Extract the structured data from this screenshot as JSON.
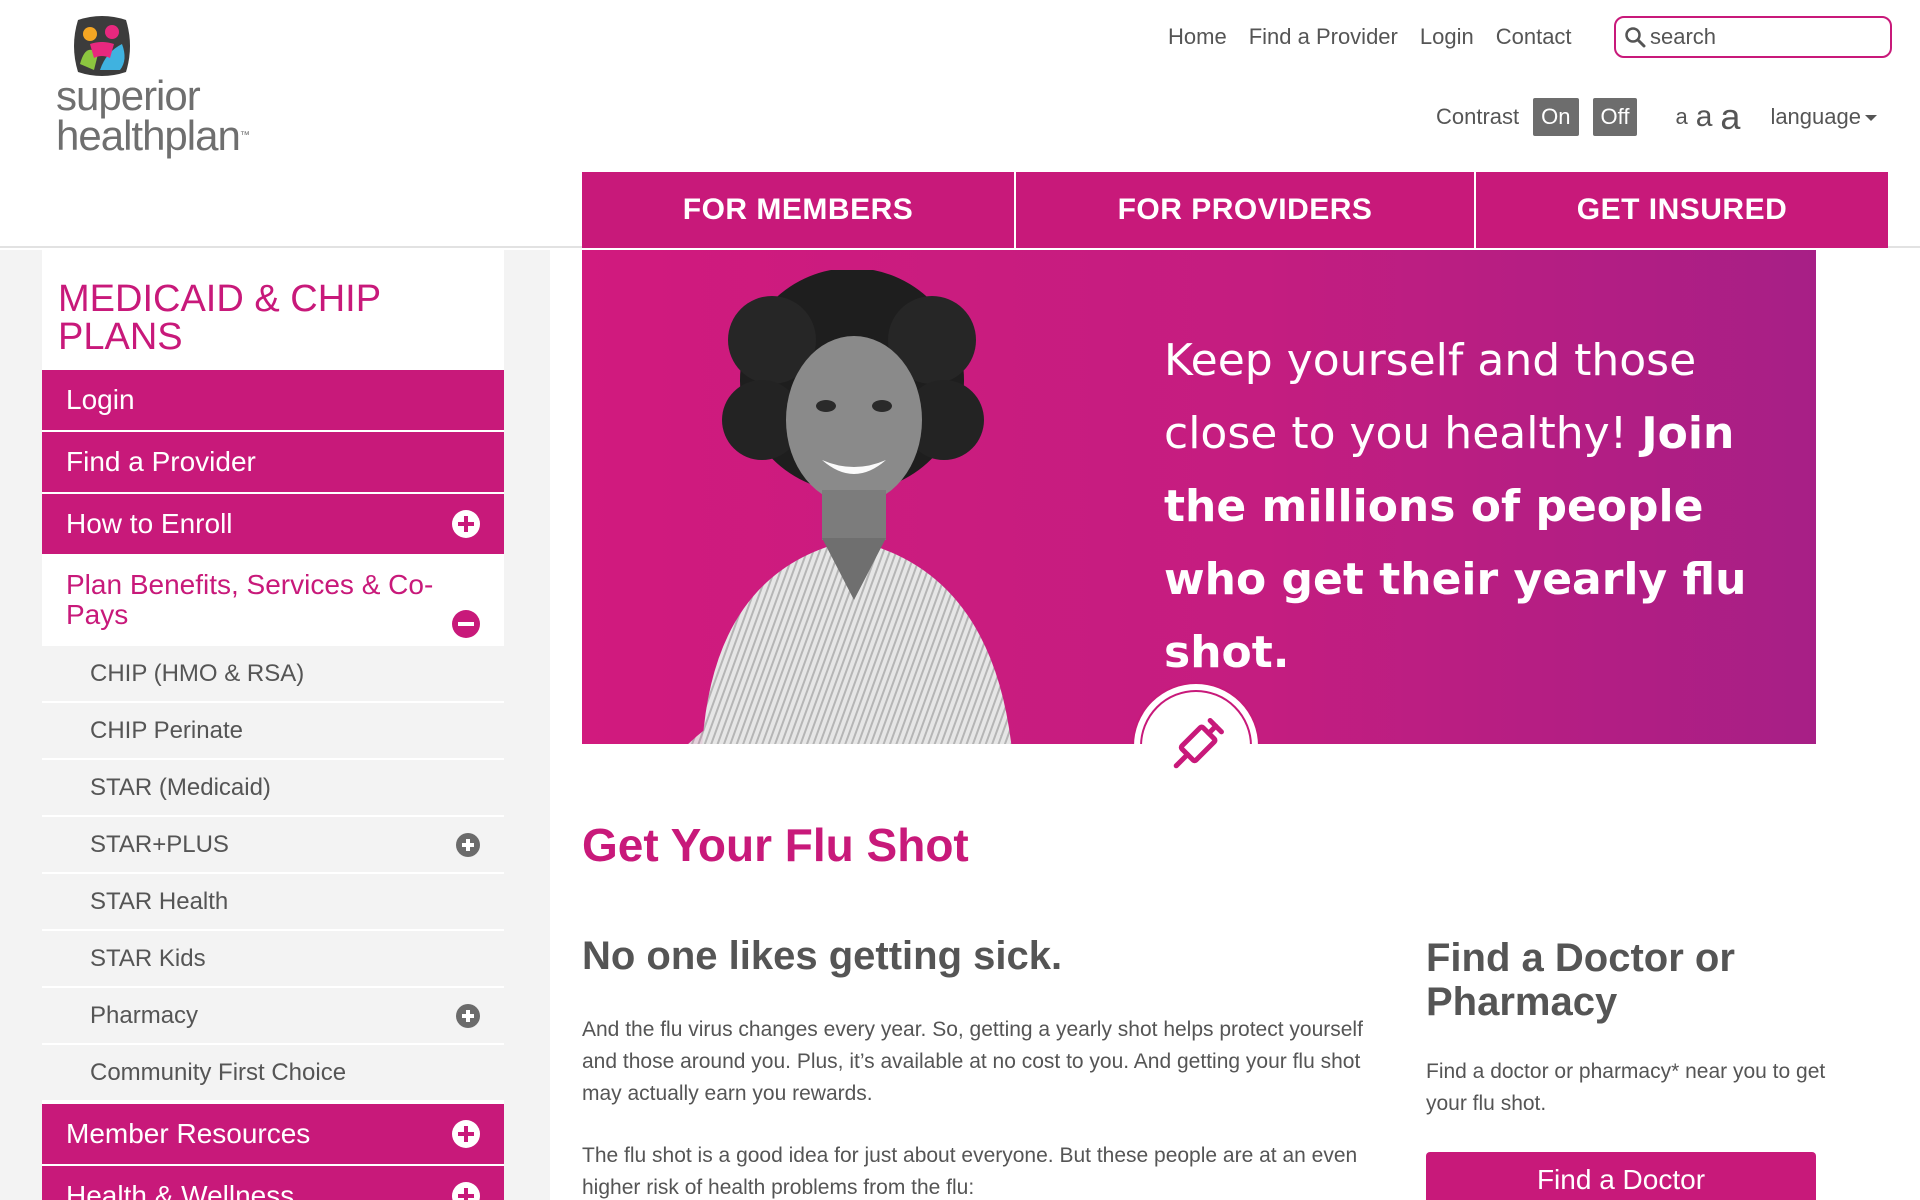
{
  "brand": {
    "logo_line1": "superior",
    "logo_line2": "healthplan",
    "logo_tm": "™"
  },
  "utility_nav": [
    "Home",
    "Find a Provider",
    "Login",
    "Contact"
  ],
  "search": {
    "placeholder": "search"
  },
  "accessibility": {
    "contrast_label": "Contrast",
    "contrast_on": "On",
    "contrast_off": "Off",
    "text_sizes": [
      "a",
      "a",
      "a"
    ],
    "language_label": "language"
  },
  "main_nav": [
    "FOR MEMBERS",
    "FOR PROVIDERS",
    "GET INSURED"
  ],
  "sidebar": {
    "title": "MEDICAID & CHIP PLANS",
    "items": [
      {
        "label": "Login",
        "icon": ""
      },
      {
        "label": "Find a Provider",
        "icon": ""
      },
      {
        "label": "How to Enroll",
        "icon": "plus-circle-icon"
      },
      {
        "label": "Plan Benefits, Services & Co-Pays",
        "icon": "minus-circle-icon",
        "active": true
      },
      {
        "label": "Member Resources",
        "icon": "plus-circle-icon"
      },
      {
        "label": "Health & Wellness",
        "icon": "plus-circle-icon"
      }
    ],
    "sub_items": [
      {
        "label": "CHIP (HMO & RSA)",
        "expandable": false
      },
      {
        "label": "CHIP Perinate",
        "expandable": false
      },
      {
        "label": "STAR (Medicaid)",
        "expandable": false
      },
      {
        "label": "STAR+PLUS",
        "expandable": true
      },
      {
        "label": "STAR Health",
        "expandable": false
      },
      {
        "label": "STAR Kids",
        "expandable": false
      },
      {
        "label": "Pharmacy",
        "expandable": true
      },
      {
        "label": "Community First Choice",
        "expandable": false
      }
    ]
  },
  "hero": {
    "text_regular": "Keep yourself and those close to you healthy! ",
    "text_bold": "Join the millions of people who get their yearly flu shot.",
    "badge_icon": "syringe-icon"
  },
  "content": {
    "page_title": "Get Your Flu Shot",
    "heading": "No one likes getting sick.",
    "para1": "And the flu virus changes every year. So, getting a yearly shot helps protect yourself and those around you. Plus, it’s available at no cost to you. And getting your flu shot may actually earn you rewards.",
    "para2": "The flu shot is a good idea for just about everyone. But these people are at an even higher risk of health problems from the flu:"
  },
  "aside": {
    "heading": "Find a Doctor or Pharmacy",
    "text": "Find a doctor or pharmacy* near you to get your flu shot.",
    "button": "Find a Doctor"
  },
  "colors": {
    "brand_magenta": "#c8197a",
    "text_gray": "#555555",
    "sidebar_gray": "#f3f3f3"
  }
}
